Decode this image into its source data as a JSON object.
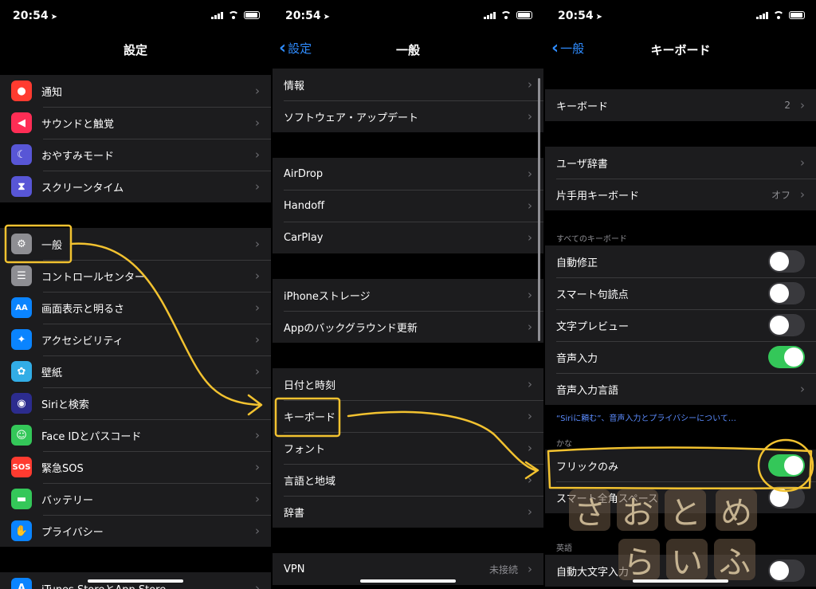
{
  "status": {
    "time": "20:54"
  },
  "colors": {
    "accent": "#2f8cff",
    "toggle_on": "#34c759",
    "annotation": "#f2c230"
  },
  "panel1": {
    "title": "設定",
    "group1": [
      {
        "label": "通知",
        "icon": "bell-icon",
        "color": "#ff3b30",
        "glyph": "●"
      },
      {
        "label": "サウンドと触覚",
        "icon": "speaker-icon",
        "color": "#ff2d55",
        "glyph": "◀"
      },
      {
        "label": "おやすみモード",
        "icon": "moon-icon",
        "color": "#5856d6",
        "glyph": "☾"
      },
      {
        "label": "スクリーンタイム",
        "icon": "hourglass-icon",
        "color": "#5856d6",
        "glyph": "⧗"
      }
    ],
    "group2": [
      {
        "label": "一般",
        "icon": "gear-icon",
        "color": "#8e8e93",
        "glyph": "⚙"
      },
      {
        "label": "コントロールセンター",
        "icon": "switches-icon",
        "color": "#8e8e93",
        "glyph": "☰"
      },
      {
        "label": "画面表示と明るさ",
        "icon": "text-size-icon",
        "color": "#0a84ff",
        "glyph": "AA"
      },
      {
        "label": "アクセシビリティ",
        "icon": "accessibility-icon",
        "color": "#0a84ff",
        "glyph": "✦"
      },
      {
        "label": "壁紙",
        "icon": "flower-icon",
        "color": "#32ade6",
        "glyph": "✿"
      },
      {
        "label": "Siriと検索",
        "icon": "siri-icon",
        "color": "#2c2c8e",
        "glyph": "◉"
      },
      {
        "label": "Face IDとパスコード",
        "icon": "face-id-icon",
        "color": "#34c759",
        "glyph": "☺"
      },
      {
        "label": "緊急SOS",
        "icon": "sos-icon",
        "color": "#ff3b30",
        "glyph": "SOS"
      },
      {
        "label": "バッテリー",
        "icon": "battery-icon",
        "color": "#34c759",
        "glyph": "▬"
      },
      {
        "label": "プライバシー",
        "icon": "hand-icon",
        "color": "#0a84ff",
        "glyph": "✋"
      }
    ],
    "group3": [
      {
        "label": "iTunes StoreとApp Store",
        "icon": "app-store-icon",
        "color": "#0a84ff",
        "glyph": "A"
      }
    ]
  },
  "panel2": {
    "back": "設定",
    "title": "一般",
    "group1": [
      {
        "label": "情報"
      },
      {
        "label": "ソフトウェア・アップデート"
      }
    ],
    "group2": [
      {
        "label": "AirDrop"
      },
      {
        "label": "Handoff"
      },
      {
        "label": "CarPlay"
      }
    ],
    "group3": [
      {
        "label": "iPhoneストレージ"
      },
      {
        "label": "Appのバックグラウンド更新"
      }
    ],
    "group4": [
      {
        "label": "日付と時刻"
      },
      {
        "label": "キーボード"
      },
      {
        "label": "フォント"
      },
      {
        "label": "言語と地域"
      },
      {
        "label": "辞書"
      }
    ],
    "group5": [
      {
        "label": "VPN",
        "detail": "未接続"
      }
    ]
  },
  "panel3": {
    "back": "一般",
    "title": "キーボード",
    "keyboards": {
      "label": "キーボード",
      "detail": "2"
    },
    "group2": [
      {
        "label": "ユーザ辞書",
        "detail": ""
      },
      {
        "label": "片手用キーボード",
        "detail": "オフ"
      }
    ],
    "section_all": "すべてのキーボード",
    "group3": [
      {
        "label": "自動修正",
        "on": false
      },
      {
        "label": "スマート句読点",
        "on": false
      },
      {
        "label": "文字プレビュー",
        "on": false
      },
      {
        "label": "音声入力",
        "on": true
      }
    ],
    "dictation_language": "音声入力言語",
    "footer_link": "“Siriに頼む”、音声入力とプライバシーについて…",
    "section_kana": "かな",
    "kana": [
      {
        "label": "フリックのみ",
        "on": true
      },
      {
        "label": "スマート全角スペース",
        "on": false
      }
    ],
    "section_en": "英語",
    "english": [
      {
        "label": "自動大文字入力",
        "on": false
      }
    ]
  },
  "watermark": {
    "chars": [
      "さ",
      "お",
      "と",
      "め",
      "ら",
      "い",
      "ふ"
    ]
  }
}
